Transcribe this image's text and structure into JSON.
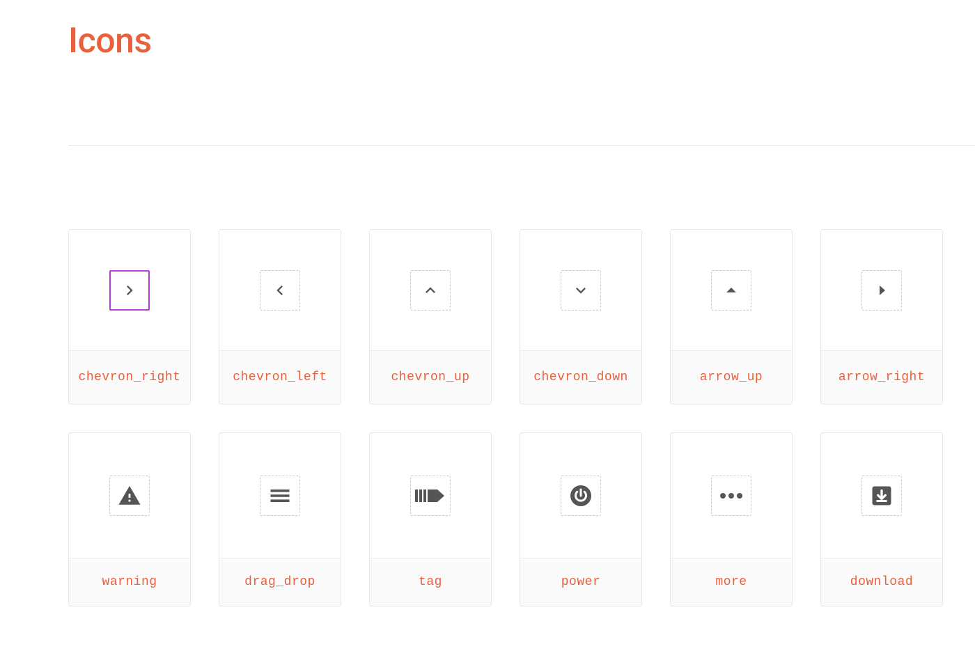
{
  "title": "Icons",
  "selected_index": 0,
  "icons": [
    {
      "name": "chevron_right",
      "kind": "chevron_right"
    },
    {
      "name": "chevron_left",
      "kind": "chevron_left"
    },
    {
      "name": "chevron_up",
      "kind": "chevron_up"
    },
    {
      "name": "chevron_down",
      "kind": "chevron_down"
    },
    {
      "name": "arrow_up",
      "kind": "arrow_up"
    },
    {
      "name": "arrow_right",
      "kind": "arrow_right"
    },
    {
      "name": "warning",
      "kind": "warning"
    },
    {
      "name": "drag_drop",
      "kind": "drag_drop"
    },
    {
      "name": "tag",
      "kind": "tag"
    },
    {
      "name": "power",
      "kind": "power"
    },
    {
      "name": "more",
      "kind": "more"
    },
    {
      "name": "download",
      "kind": "download"
    }
  ]
}
